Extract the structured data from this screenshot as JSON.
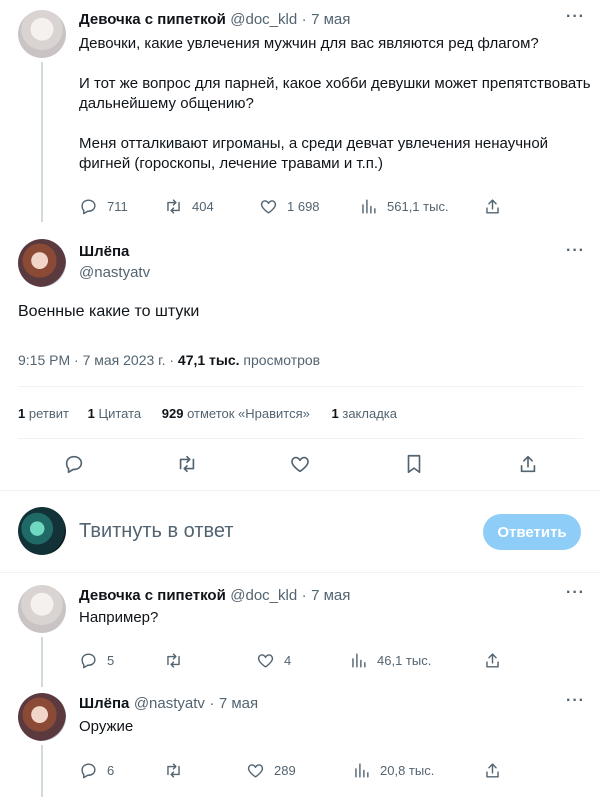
{
  "tweet1": {
    "author_name": "Девочка с пипеткой",
    "handle": "@doc_kld",
    "sep": "·",
    "date": "7 мая",
    "lines": [
      "Девочки, какие увлечения мужчин для вас являются ред флагом?",
      "И тот же вопрос для парней, какое хобби девушки может препятствовать",
      "дальнейшему общению?",
      "Меня отталкивают игроманы, а среди девчат увлечения ненаучной",
      "фигней (гороскопы, лечение травами и т.п.)"
    ],
    "replies": "711",
    "retweets": "404",
    "likes": "1 698",
    "views": "561,1 тыс."
  },
  "main": {
    "author_name": "Шлёпа",
    "handle": "@nastyatv",
    "text": "Военные какие то штуки",
    "time": "9:15 PM · 7 мая 2023 г. · ",
    "views_count": "47,1 тыс.",
    "views_label": " просмотров",
    "stats": {
      "retweets_count": "1",
      "retweets_label": "ретвит",
      "quotes_count": "1",
      "quotes_label": "Цитата",
      "likes_count": "929",
      "likes_label": "отметок «Нравится»",
      "bookmarks_count": "1",
      "bookmarks_label": "закладка"
    }
  },
  "composer": {
    "placeholder": "Твитнуть в ответ",
    "button": "Ответить"
  },
  "reply1": {
    "author_name": "Девочка с пипеткой",
    "handle": "@doc_kld",
    "sep": "·",
    "date": "7 мая",
    "text": "Например?",
    "replies": "5",
    "retweets": "",
    "likes": "4",
    "views": "46,1 тыс."
  },
  "reply2": {
    "author_name": "Шлёпа",
    "handle": "@nastyatv",
    "sep": "·",
    "date": "7 мая",
    "text": "Оружие",
    "replies": "6",
    "retweets": "",
    "likes": "289",
    "views": "20,8 тыс."
  },
  "more_label": "···",
  "icons": [
    "reply-icon",
    "retweet-icon",
    "like-icon",
    "views-icon",
    "share-icon",
    "bookmark-icon",
    "more-icon"
  ],
  "colors": {
    "accent": "#1d9bf0",
    "button_disabled": "#8ecdf8",
    "muted": "#536471",
    "divider": "#eff3f4"
  }
}
